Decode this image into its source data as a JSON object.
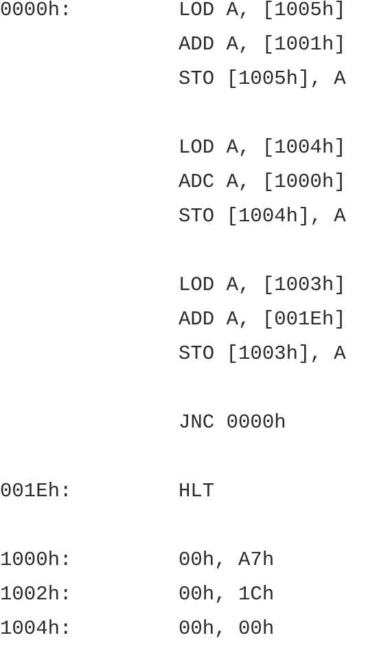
{
  "listing": {
    "lines": [
      {
        "label": "0000h:",
        "code": "LOD A, [1005h]"
      },
      {
        "label": "",
        "code": "ADD A, [1001h]"
      },
      {
        "label": "",
        "code": "STO [1005h], A"
      },
      {
        "label": "",
        "code": "LOD A, [1004h]"
      },
      {
        "label": "",
        "code": "ADC A, [1000h]"
      },
      {
        "label": "",
        "code": "STO [1004h], A"
      },
      {
        "label": "",
        "code": "LOD A, [1003h]"
      },
      {
        "label": "",
        "code": "ADD A, [001Eh]"
      },
      {
        "label": "",
        "code": "STO [1003h], A"
      },
      {
        "label": "",
        "code": "JNC 0000h"
      },
      {
        "label": "001Eh:",
        "code": "HLT"
      },
      {
        "label": "1000h:",
        "code": "00h, A7h"
      },
      {
        "label": "1002h:",
        "code": "00h, 1Ch"
      },
      {
        "label": "1004h:",
        "code": "00h, 00h"
      }
    ]
  }
}
